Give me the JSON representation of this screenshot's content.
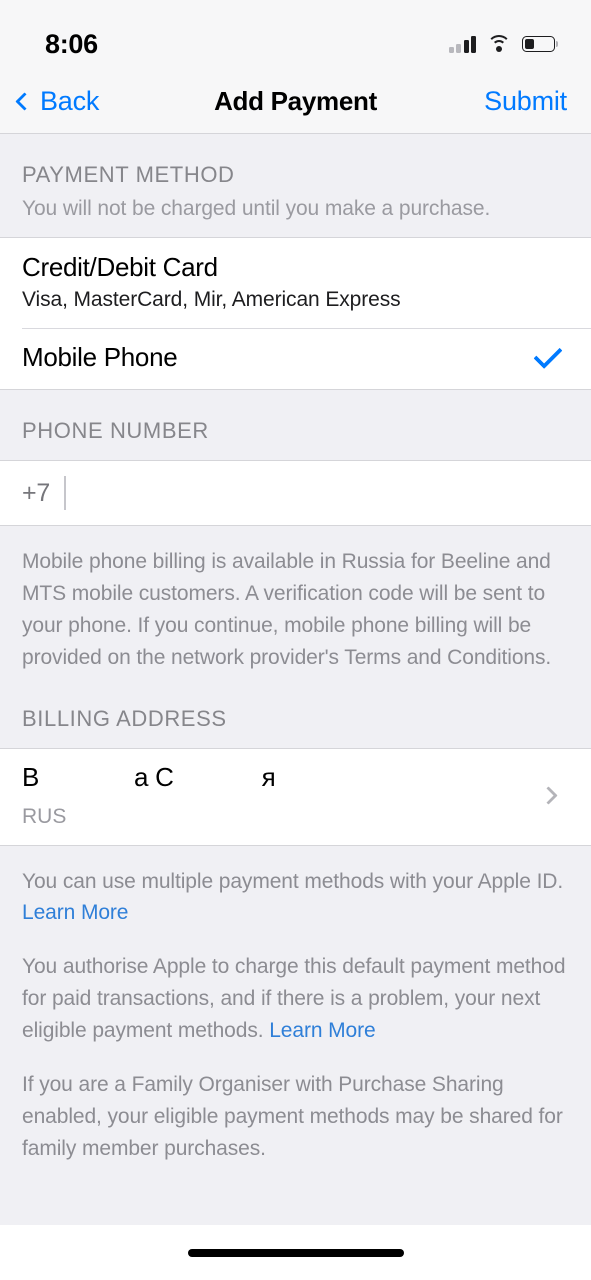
{
  "status_bar": {
    "time": "8:06",
    "signal_icon": "cellular-signal-icon",
    "wifi_icon": "wifi-icon",
    "battery_icon": "battery-icon",
    "battery_level_percent": 32,
    "signal_bars_filled": 2,
    "signal_bars_total": 4
  },
  "nav_bar": {
    "back_label": "Back",
    "back_icon": "chevron-left-icon",
    "title": "Add Payment",
    "submit_label": "Submit",
    "accent_color": "#007aff"
  },
  "payment_method": {
    "section_title": "PAYMENT METHOD",
    "section_subtitle": "You will not be charged until you make a purchase.",
    "options": [
      {
        "title": "Credit/Debit Card",
        "subtitle": "Visa, MasterCard, Mir, American Express",
        "selected": false
      },
      {
        "title": "Mobile Phone",
        "subtitle": "",
        "selected": true
      }
    ],
    "check_icon": "checkmark-icon"
  },
  "phone_number": {
    "section_title": "PHONE NUMBER",
    "country_prefix": "+7",
    "value": "",
    "footnote": "Mobile phone billing is available in Russia for Beeline and MTS mobile customers. A verification code will be sent to your phone. If you continue, mobile phone billing will be provided on the network provider's Terms and Conditions."
  },
  "billing_address": {
    "section_title": "BILLING ADDRESS",
    "name_fragment_1": "В",
    "name_fragment_2": "а С",
    "name_fragment_3": "я",
    "country": "RUS",
    "disclosure_icon": "chevron-right-icon"
  },
  "footnotes": {
    "multiple_methods_text": "You can use multiple payment methods with your Apple ID. ",
    "multiple_methods_link": "Learn More",
    "authorise_text": "You authorise Apple to charge this default payment method for paid transactions, and if there is a problem, your next eligible payment methods. ",
    "authorise_link": "Learn More",
    "family_text": "If you are a Family Organiser with Purchase Sharing enabled, your eligible payment methods may be shared for family member purchases.",
    "link_color": "#2f7fd8"
  },
  "home_indicator": "home-indicator"
}
